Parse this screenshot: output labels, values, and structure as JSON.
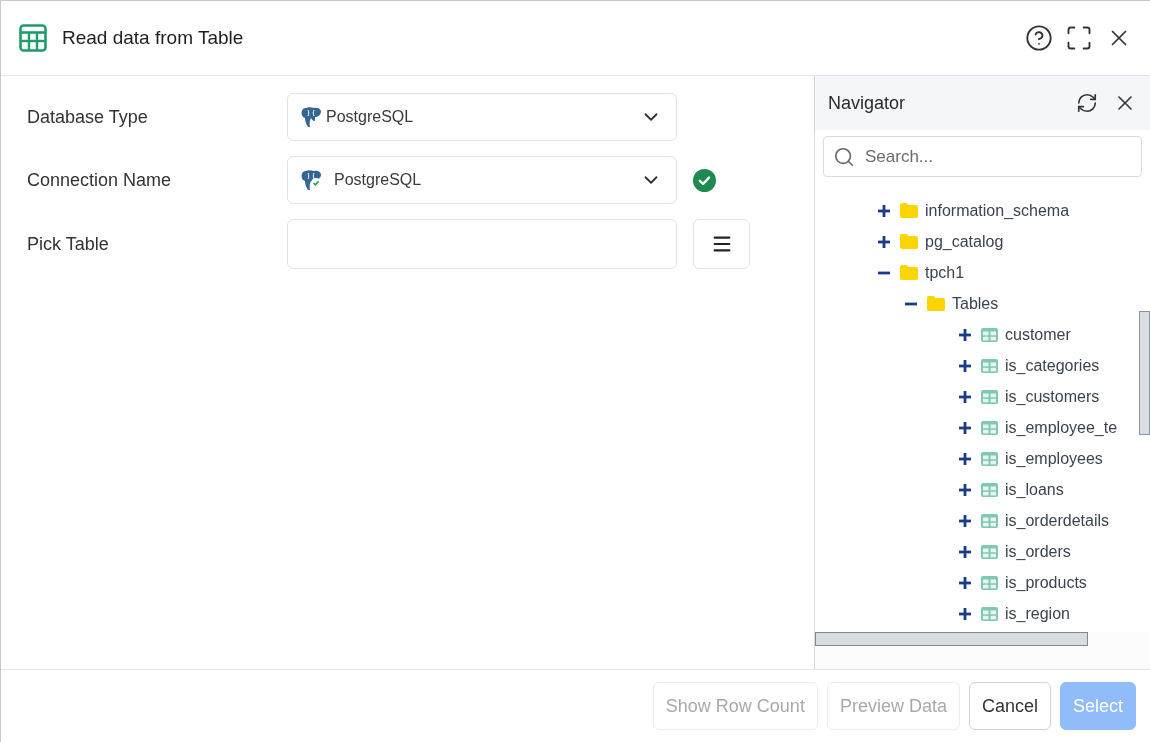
{
  "dialog": {
    "title": "Read data from Table"
  },
  "form": {
    "fields": [
      {
        "kind": "select",
        "label": "Database Type",
        "value": "PostgreSQL",
        "verified": false
      },
      {
        "kind": "select",
        "label": "Connection Name",
        "value": "PostgreSQL",
        "verified": true
      },
      {
        "kind": "picker",
        "label": "Pick Table"
      }
    ]
  },
  "navigator": {
    "title": "Navigator",
    "search": {
      "placeholder": "Search..."
    },
    "tree": [
      {
        "label": "information_schema",
        "kind": "folder",
        "expanded": false
      },
      {
        "label": "pg_catalog",
        "kind": "folder",
        "expanded": false
      },
      {
        "label": "tpch1",
        "kind": "folder",
        "expanded": true,
        "children": [
          {
            "label": "Tables",
            "kind": "folder",
            "expanded": true,
            "children": [
              {
                "label": "customer",
                "kind": "table",
                "expanded": false
              },
              {
                "label": "is_categories",
                "kind": "table",
                "expanded": false
              },
              {
                "label": "is_customers",
                "kind": "table",
                "expanded": false
              },
              {
                "label": "is_employee_te",
                "kind": "table",
                "expanded": false
              },
              {
                "label": "is_employees",
                "kind": "table",
                "expanded": false
              },
              {
                "label": "is_loans",
                "kind": "table",
                "expanded": false
              },
              {
                "label": "is_orderdetails",
                "kind": "table",
                "expanded": false
              },
              {
                "label": "is_orders",
                "kind": "table",
                "expanded": false
              },
              {
                "label": "is_products",
                "kind": "table",
                "expanded": false
              },
              {
                "label": "is_region",
                "kind": "table",
                "expanded": false
              }
            ]
          }
        ]
      }
    ]
  },
  "footer": {
    "buttons": [
      {
        "label": "Show Row Count",
        "kind": "secondary",
        "disabled": true
      },
      {
        "label": "Preview Data",
        "kind": "secondary",
        "disabled": true
      },
      {
        "label": "Cancel",
        "kind": "secondary",
        "disabled": false
      },
      {
        "label": "Select",
        "kind": "primary",
        "disabled": true
      }
    ]
  }
}
